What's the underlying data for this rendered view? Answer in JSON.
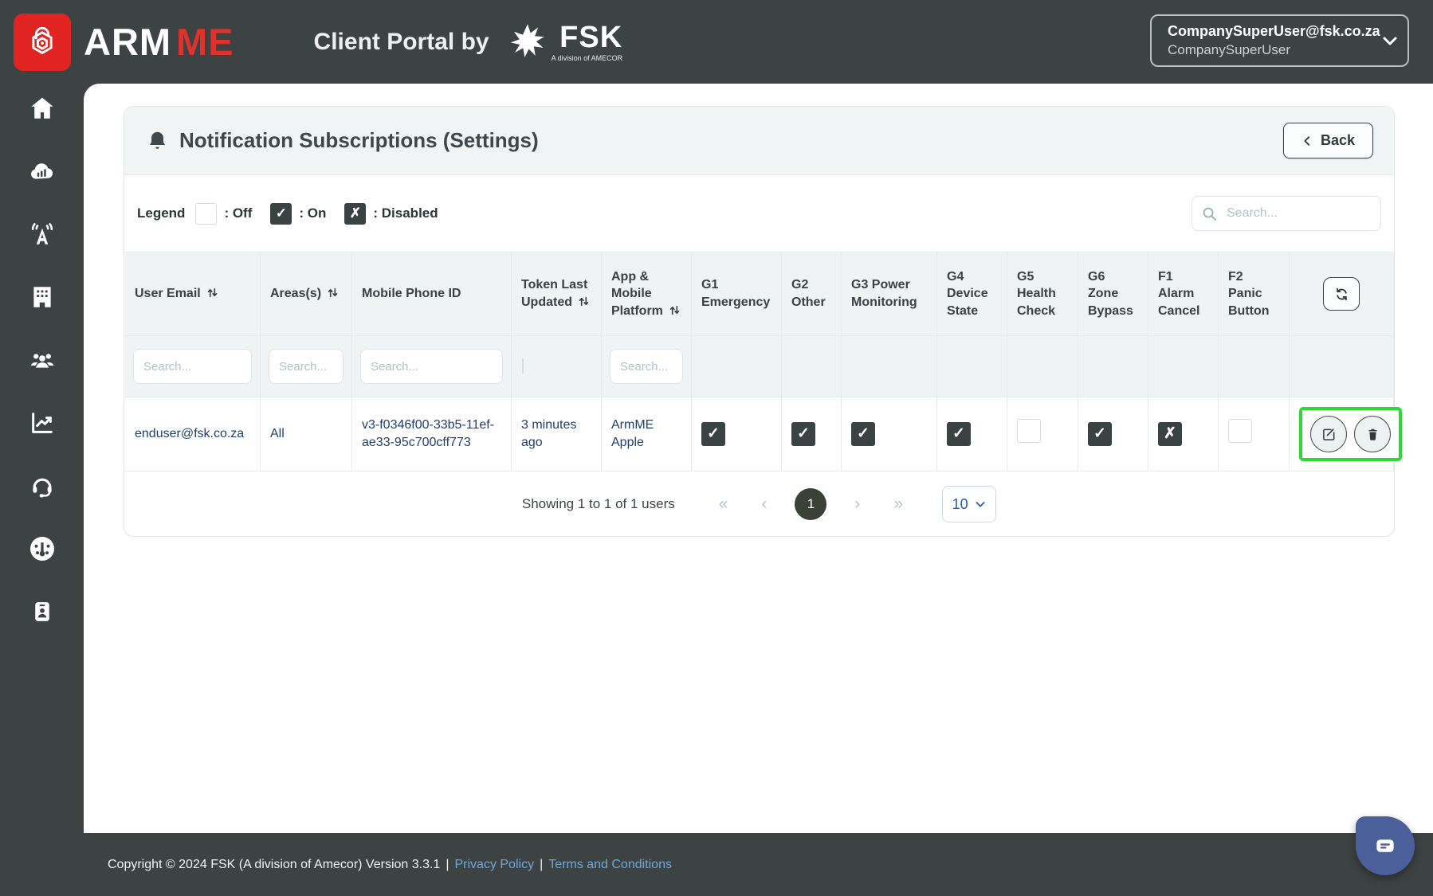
{
  "header": {
    "brand_arm": "ARM",
    "brand_me": "ME",
    "portal_title": "Client Portal by",
    "fsk_name": "FSK",
    "fsk_subtitle": "A division of AMECOR",
    "user_email": "CompanySuperUser@fsk.co.za",
    "user_name": "CompanySuperUser"
  },
  "sidebar": {
    "items": [
      {
        "icon": "home"
      },
      {
        "icon": "cloud-stats"
      },
      {
        "icon": "radio-tower"
      },
      {
        "icon": "building"
      },
      {
        "icon": "users"
      },
      {
        "icon": "line-chart"
      },
      {
        "icon": "headset"
      },
      {
        "icon": "gauge"
      },
      {
        "icon": "id-card"
      }
    ]
  },
  "page": {
    "title": "Notification Subscriptions (Settings)",
    "back_label": "Back"
  },
  "legend": {
    "label": "Legend",
    "off_label": ": Off",
    "on_label": ": On",
    "disabled_label": ": Disabled"
  },
  "search": {
    "placeholder": "Search..."
  },
  "table": {
    "filter_placeholder": "Search...",
    "columns": [
      {
        "label": "User Email",
        "sortable": true
      },
      {
        "label": "Areas(s)",
        "sortable": true
      },
      {
        "label": "Mobile Phone ID",
        "sortable": false
      },
      {
        "label": "Token Last Updated",
        "sortable": true
      },
      {
        "label": "App & Mobile Platform",
        "sortable": true
      },
      {
        "label": "G1 Emergency",
        "sortable": false
      },
      {
        "label": "G2 Other",
        "sortable": false
      },
      {
        "label": "G3 Power Monitoring",
        "sortable": false
      },
      {
        "label": "G4 Device State",
        "sortable": false
      },
      {
        "label": "G5 Health Check",
        "sortable": false
      },
      {
        "label": "G6 Zone Bypass",
        "sortable": false
      },
      {
        "label": "F1 Alarm Cancel",
        "sortable": false
      },
      {
        "label": "F2 Panic Button",
        "sortable": false
      }
    ],
    "rows": [
      {
        "user_email": "enduser@fsk.co.za",
        "areas": "All",
        "mobile_phone_id": "v3-f0346f00-33b5-11ef-ae33-95c700cff773",
        "token_last_updated": "3 minutes ago",
        "app_platform": "ArmME Apple",
        "g1_emergency": "on",
        "g2_other": "on",
        "g3_power_monitoring": "on",
        "g4_device_state": "on",
        "g5_health_check": "off",
        "g6_zone_bypass": "on",
        "f1_alarm_cancel": "disabled",
        "f2_panic_button": "off"
      }
    ]
  },
  "pagination": {
    "summary": "Showing 1 to 1 of 1 users",
    "current_page": "1",
    "page_size": "10"
  },
  "footer": {
    "copyright": "Copyright © 2024 FSK (A division of Amecor) Version 3.3.1",
    "separator": "|",
    "links": [
      {
        "label": "Privacy Policy"
      },
      {
        "label": "Terms and Conditions"
      }
    ]
  },
  "icons": {
    "check": "✓",
    "cross": "✗",
    "first": "«",
    "prev": "‹",
    "next": "›",
    "last": "»"
  },
  "colors": {
    "dark": "#3d4243",
    "brand_red": "#e02421",
    "row_text_navy": "#1e3f70",
    "highlight_green": "#2fd834",
    "chat_blue": "#4b609b"
  }
}
